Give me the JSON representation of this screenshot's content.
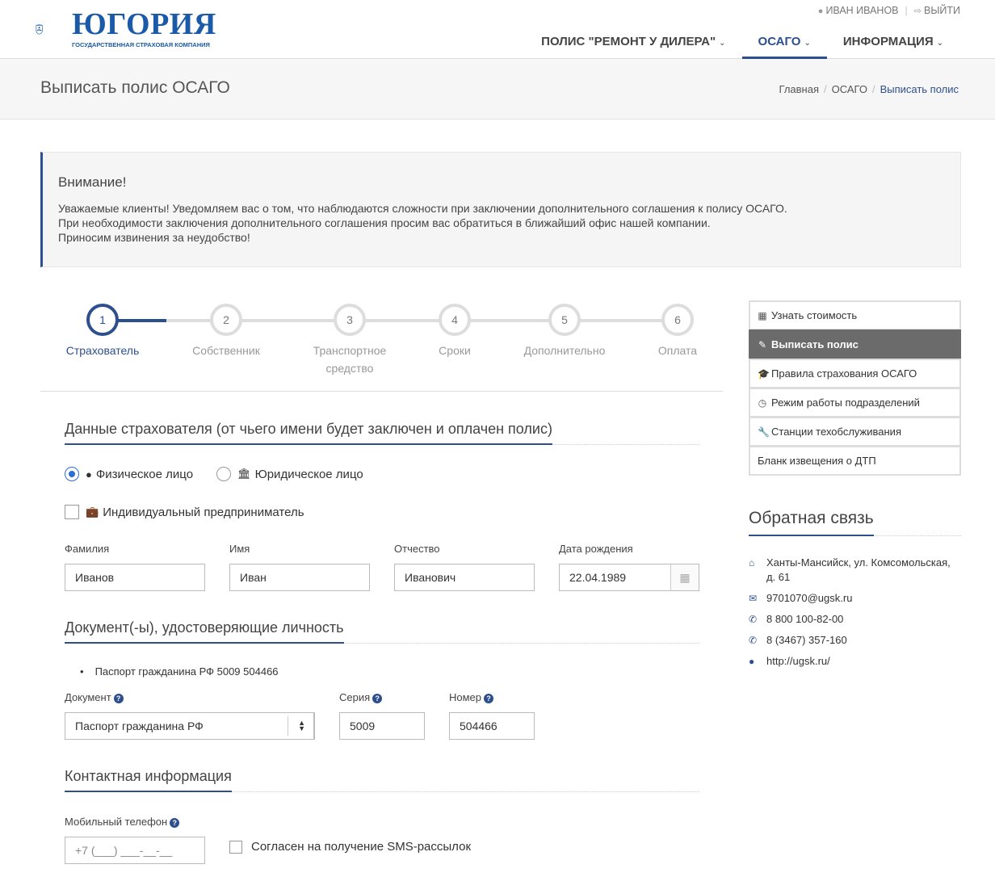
{
  "header": {
    "logo_text": "ЮГОРИЯ",
    "logo_subtitle": "ГОСУДАРСТВЕННАЯ СТРАХОВАЯ КОМПАНИЯ",
    "user_name": "ИВАН ИВАНОВ",
    "logout": "ВЫЙТИ",
    "nav": [
      {
        "label": "ПОЛИС \"РЕМОНТ У ДИЛЕРА\"",
        "active": false
      },
      {
        "label": "ОСАГО",
        "active": true
      },
      {
        "label": "ИНФОРМАЦИЯ",
        "active": false
      }
    ]
  },
  "title_bar": {
    "title": "Выписать полис ОСАГО",
    "breadcrumb": [
      "Главная",
      "ОСАГО",
      "Выписать полис"
    ]
  },
  "alert": {
    "heading": "Внимание!",
    "lines": [
      "Уважаемые клиенты! Уведомляем вас о том, что наблюдаются сложности при заключении дополнительного соглашения к полису ОСАГО.",
      "При необходимости заключения дополнительного соглашения просим вас обратиться в ближайший офис нашей компании.",
      "Приносим извинения за неудобство!"
    ]
  },
  "stepper": {
    "current_step": 1,
    "steps": [
      {
        "num": "1",
        "label": "Страхователь"
      },
      {
        "num": "2",
        "label": "Собственник"
      },
      {
        "num": "3",
        "label": "Транспортное средство"
      },
      {
        "num": "4",
        "label": "Сроки"
      },
      {
        "num": "5",
        "label": "Дополнительно"
      },
      {
        "num": "6",
        "label": "Оплата"
      }
    ]
  },
  "insurer": {
    "section_title": "Данные страхователя (от чьего имени будет заключен и оплачен полис)",
    "type_individual": "Физическое лицо",
    "type_legal": "Юридическое лицо",
    "selected_type": "individual",
    "entrepreneur_label": "Индивидуальный предприниматель",
    "entrepreneur_checked": false,
    "fields": {
      "last_name": {
        "label": "Фамилия",
        "value": "Иванов"
      },
      "first_name": {
        "label": "Имя",
        "value": "Иван"
      },
      "middle_name": {
        "label": "Отчество",
        "value": "Иванович"
      },
      "birth_date": {
        "label": "Дата рождения",
        "value": "22.04.1989"
      }
    }
  },
  "documents": {
    "section_title": "Документ(-ы), удостоверяющие личность",
    "list": [
      "Паспорт гражданина РФ 5009 504466"
    ],
    "doc_label": "Документ",
    "doc_value": "Паспорт гражданина РФ",
    "series_label": "Серия",
    "series_value": "5009",
    "number_label": "Номер",
    "number_value": "504466"
  },
  "contact": {
    "section_title": "Контактная информация",
    "phone_label": "Мобильный телефон",
    "phone_placeholder": "+7 (___) ___-__-__",
    "sms_label": "Согласен на получение SMS-рассылок",
    "sms_checked": false
  },
  "sidebar": {
    "menu": [
      {
        "label": "Узнать стоимость",
        "icon": "calculator-icon",
        "active": false
      },
      {
        "label": "Выписать полис",
        "icon": "edit-icon",
        "active": true
      },
      {
        "label": "Правила страхования ОСАГО",
        "icon": "graduation-cap-icon",
        "active": false
      },
      {
        "label": "Режим работы подразделений",
        "icon": "clock-icon",
        "active": false
      },
      {
        "label": "Станции техобслуживания",
        "icon": "wrench-icon",
        "active": false
      },
      {
        "label": "Бланк извещения о ДТП",
        "icon": "",
        "active": false
      }
    ],
    "feedback_title": "Обратная связь",
    "contacts": [
      {
        "icon": "home-icon",
        "text": "Ханты-Мансийск, ул. Комсомольская, д. 61"
      },
      {
        "icon": "envelope-icon",
        "text": "9701070@ugsk.ru"
      },
      {
        "icon": "phone-icon",
        "text": "8 800 100-82-00"
      },
      {
        "icon": "phone-icon",
        "text": "8 (3467) 357-160"
      },
      {
        "icon": "globe-icon",
        "text": "http://ugsk.ru/"
      }
    ]
  },
  "colors": {
    "accent": "#2d4f8e",
    "brand": "#1a5aa6",
    "radio_on": "#2d6dd6",
    "sidebar_active": "#6b6b6b"
  }
}
